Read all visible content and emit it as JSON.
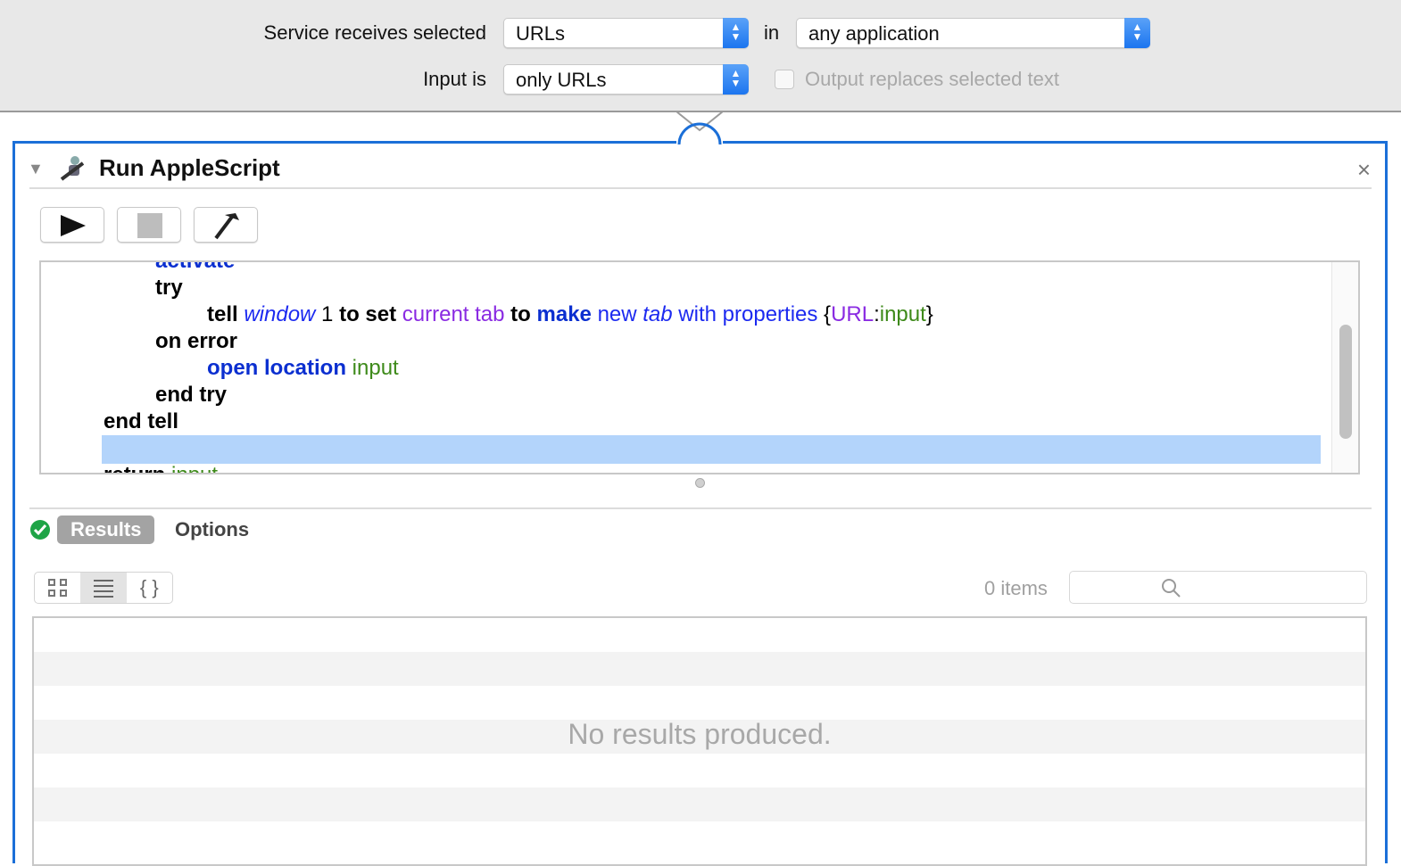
{
  "top": {
    "receives_label": "Service receives selected",
    "receives_value": "URLs",
    "in_label": "in",
    "app_value": "any application",
    "input_label": "Input is",
    "input_value": "only URLs",
    "output_checkbox_label": "Output replaces selected text",
    "output_checked": false
  },
  "action": {
    "title": "Run AppleScript",
    "close": "×"
  },
  "code": {
    "lines": [
      {
        "indent": 2,
        "tokens": [
          {
            "t": "activate",
            "c": "kb"
          }
        ]
      },
      {
        "indent": 2,
        "tokens": [
          {
            "t": "try",
            "c": "k"
          }
        ]
      },
      {
        "indent": 3,
        "tokens": [
          {
            "t": "tell ",
            "c": "k"
          },
          {
            "t": "window",
            "c": "vb"
          },
          {
            "t": " 1 ",
            "c": "n"
          },
          {
            "t": "to set ",
            "c": "k"
          },
          {
            "t": "current tab ",
            "c": "pu"
          },
          {
            "t": "to ",
            "c": "k"
          },
          {
            "t": "make ",
            "c": "kb"
          },
          {
            "t": "new ",
            "c": "bl"
          },
          {
            "t": "tab",
            "c": "vb"
          },
          {
            "t": " with properties ",
            "c": "bl"
          },
          {
            "t": "{",
            "c": "n"
          },
          {
            "t": "URL",
            "c": "pu"
          },
          {
            "t": ":",
            "c": "n"
          },
          {
            "t": "input",
            "c": "gr"
          },
          {
            "t": "}",
            "c": "n"
          }
        ]
      },
      {
        "indent": 2,
        "tokens": [
          {
            "t": "on error",
            "c": "k"
          }
        ]
      },
      {
        "indent": 3,
        "tokens": [
          {
            "t": "open location ",
            "c": "kb"
          },
          {
            "t": "input",
            "c": "gr"
          }
        ]
      },
      {
        "indent": 2,
        "tokens": [
          {
            "t": "end try",
            "c": "k"
          }
        ]
      },
      {
        "indent": 1,
        "tokens": [
          {
            "t": "end tell",
            "c": "k"
          }
        ]
      },
      {
        "indent": 1,
        "tokens": []
      },
      {
        "indent": 1,
        "tokens": [
          {
            "t": "return ",
            "c": "k"
          },
          {
            "t": "input",
            "c": "gr"
          }
        ]
      }
    ]
  },
  "results": {
    "tab_results": "Results",
    "tab_options": "Options",
    "count": "0 items",
    "empty": "No results produced.",
    "view_json": "{ }"
  },
  "colors": {
    "accent": "#1b6fd8",
    "selection": "#b3d4fb",
    "success": "#1ea446"
  }
}
